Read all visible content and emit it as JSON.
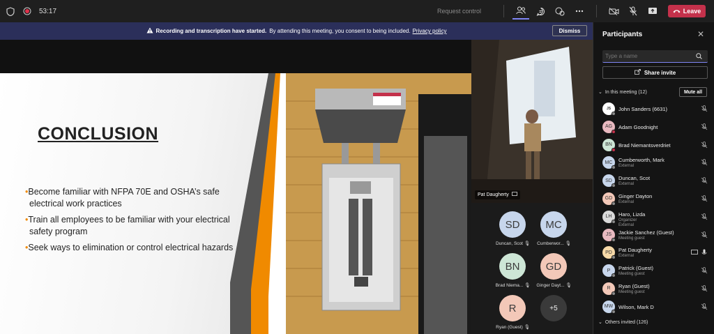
{
  "topbar": {
    "timer": "53:17",
    "request_control": "Request control",
    "leave_label": "Leave",
    "icons": [
      "shield-icon",
      "record-icon",
      "people-icon",
      "chat-icon",
      "reactions-icon",
      "more-icon",
      "camera-off-icon",
      "mic-off-icon",
      "share-screen-icon",
      "phone-icon"
    ]
  },
  "banner": {
    "bold": "Recording and transcription have started.",
    "text": "By attending this meeting, you consent to being included.",
    "link": "Privacy policy",
    "dismiss": "Dismiss"
  },
  "slide": {
    "title": "CONCLUSION",
    "bullets": [
      "Become familiar with NFPA 70E and OSHA’s safe electrical work practices",
      "Train all employees to be familiar with your electrical safety program",
      "Seek ways to elimination or control electrical hazards"
    ],
    "accent_color": "#f08a00"
  },
  "video": {
    "name": "Pat Daugherty"
  },
  "grid": {
    "tiles": [
      {
        "initials": "SD",
        "name": "Duncan, Scot",
        "color": "#c7d6ec"
      },
      {
        "initials": "MC",
        "name": "Cumberwor...",
        "color": "#c7d6ec"
      },
      {
        "initials": "BN",
        "name": "Brad Niema...",
        "color": "#cde6d6"
      },
      {
        "initials": "GD",
        "name": "Ginger Dayt...",
        "color": "#f3c8b8"
      },
      {
        "initials": "R",
        "name": "Ryan (Guest)",
        "color": "#f3c8b8"
      },
      {
        "initials": "+5",
        "name": "",
        "color": "#3a3a3a"
      }
    ]
  },
  "panel": {
    "title": "Participants",
    "search_placeholder": "Type a name",
    "share_invite": "Share invite",
    "in_meeting": "In this meeting (12)",
    "mute_all": "Mute all",
    "others_invited": "Others invited (126)",
    "participants": [
      {
        "initials": "JS",
        "name": "John Sanders (6631)",
        "sub": "",
        "color": "#ffffff",
        "status": "#8a8a8a"
      },
      {
        "initials": "AG",
        "name": "Adam Goodnight",
        "sub": "",
        "color": "#e8b9c0",
        "status": "#c4314b"
      },
      {
        "initials": "BN",
        "name": "Brad Niemantsverdriet",
        "sub": "",
        "color": "#cde6d6",
        "status": "#c4314b"
      },
      {
        "initials": "MC",
        "name": "Cumberworth, Mark",
        "sub": "External",
        "color": "#c7d6ec",
        "status": "#8a8a8a"
      },
      {
        "initials": "SD",
        "name": "Duncan, Scot",
        "sub": "External",
        "color": "#c7d6ec",
        "status": "#8a8a8a"
      },
      {
        "initials": "GD",
        "name": "Ginger Dayton",
        "sub": "External",
        "color": "#f3c8b8",
        "status": "#8a8a8a"
      },
      {
        "initials": "LH",
        "name": "Haro, Lizda",
        "sub": "Organizer",
        "color": "#d9d9d9",
        "status": "#8a8a8a",
        "sub2": "External"
      },
      {
        "initials": "JS",
        "name": "Jackie Sanchez (Guest)",
        "sub": "Meeting guest",
        "color": "#e8b9c0",
        "status": "#8a8a8a"
      },
      {
        "initials": "PD",
        "name": "Pat Daugherty",
        "sub": "External",
        "color": "#f7d9a8",
        "status": "#8a8a8a"
      },
      {
        "initials": "P",
        "name": "Patrick (Guest)",
        "sub": "Meeting guest",
        "color": "#c7d6ec",
        "status": "#8a8a8a"
      },
      {
        "initials": "R",
        "name": "Ryan (Guest)",
        "sub": "Meeting guest",
        "color": "#f3c8b8",
        "status": "#8a8a8a"
      },
      {
        "initials": "MW",
        "name": "Wilson, Mark D",
        "sub": "",
        "color": "#c7d6ec",
        "status": "#8a8a8a"
      }
    ]
  }
}
